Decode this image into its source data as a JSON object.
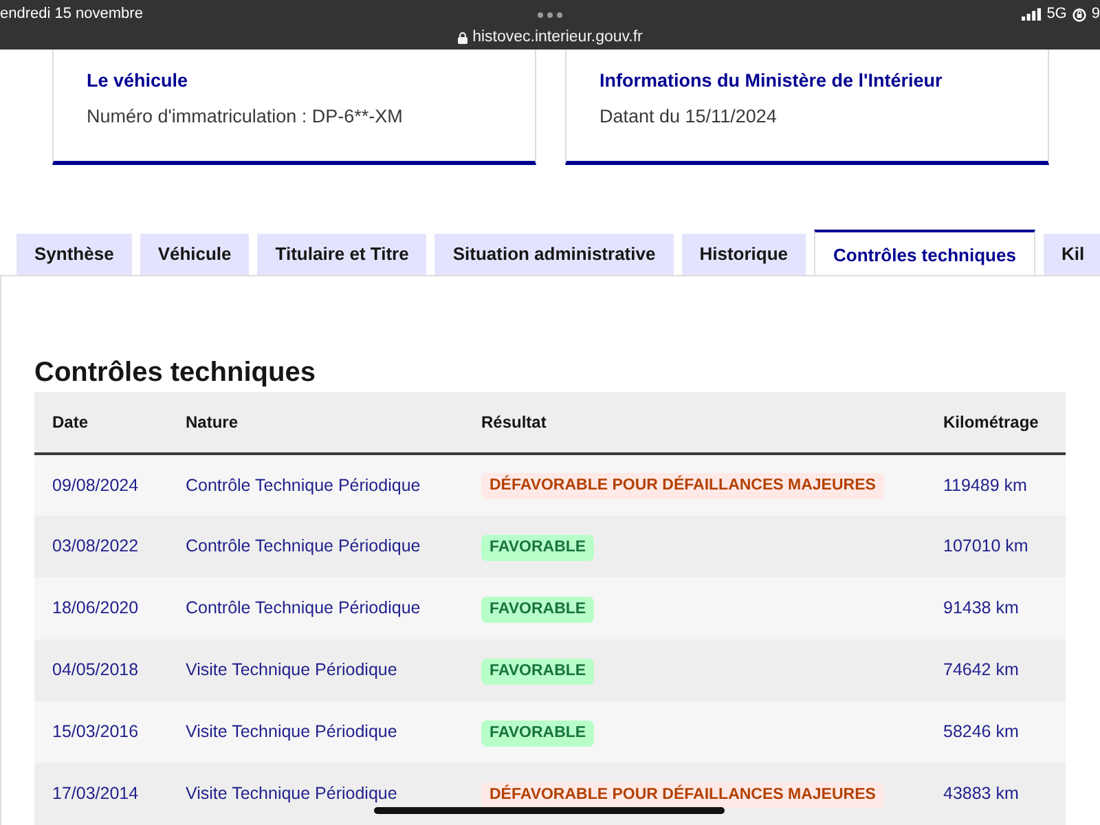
{
  "status_bar": {
    "date": "endredi 15 novembre",
    "url": "histovec.interieur.gouv.fr",
    "network": "5G",
    "battery": "9"
  },
  "cards": [
    {
      "title": "Le véhicule",
      "text": "Numéro d'immatriculation : DP-6**-XM"
    },
    {
      "title": "Informations du Ministère de l'Intérieur",
      "text": "Datant du 15/11/2024"
    }
  ],
  "tabs": [
    {
      "label": "Synthèse",
      "selected": false
    },
    {
      "label": "Véhicule",
      "selected": false
    },
    {
      "label": "Titulaire et Titre",
      "selected": false
    },
    {
      "label": "Situation administrative",
      "selected": false
    },
    {
      "label": "Historique",
      "selected": false
    },
    {
      "label": "Contrôles techniques",
      "selected": true
    },
    {
      "label": "Kil",
      "selected": false
    }
  ],
  "section": {
    "title": "Contrôles techniques",
    "table": {
      "columns": [
        "Date",
        "Nature",
        "Résultat",
        "Kilométrage"
      ],
      "rows": [
        {
          "date": "09/08/2024",
          "nature": "Contrôle Technique Périodique",
          "result": {
            "label": "DÉFAVORABLE POUR DÉFAILLANCES MAJEURES",
            "kind": "error"
          },
          "mileage": "119489 km"
        },
        {
          "date": "03/08/2022",
          "nature": "Contrôle Technique Périodique",
          "result": {
            "label": "FAVORABLE",
            "kind": "success"
          },
          "mileage": "107010 km"
        },
        {
          "date": "18/06/2020",
          "nature": "Contrôle Technique Périodique",
          "result": {
            "label": "FAVORABLE",
            "kind": "success"
          },
          "mileage": "91438 km"
        },
        {
          "date": "04/05/2018",
          "nature": "Visite Technique Périodique",
          "result": {
            "label": "FAVORABLE",
            "kind": "success"
          },
          "mileage": "74642 km"
        },
        {
          "date": "15/03/2016",
          "nature": "Visite Technique Périodique",
          "result": {
            "label": "FAVORABLE",
            "kind": "success"
          },
          "mileage": "58246 km"
        },
        {
          "date": "17/03/2014",
          "nature": "Visite Technique Périodique",
          "result": {
            "label": "DÉFAVORABLE POUR DÉFAILLANCES MAJEURES",
            "kind": "error"
          },
          "mileage": "43883 km"
        }
      ]
    }
  }
}
